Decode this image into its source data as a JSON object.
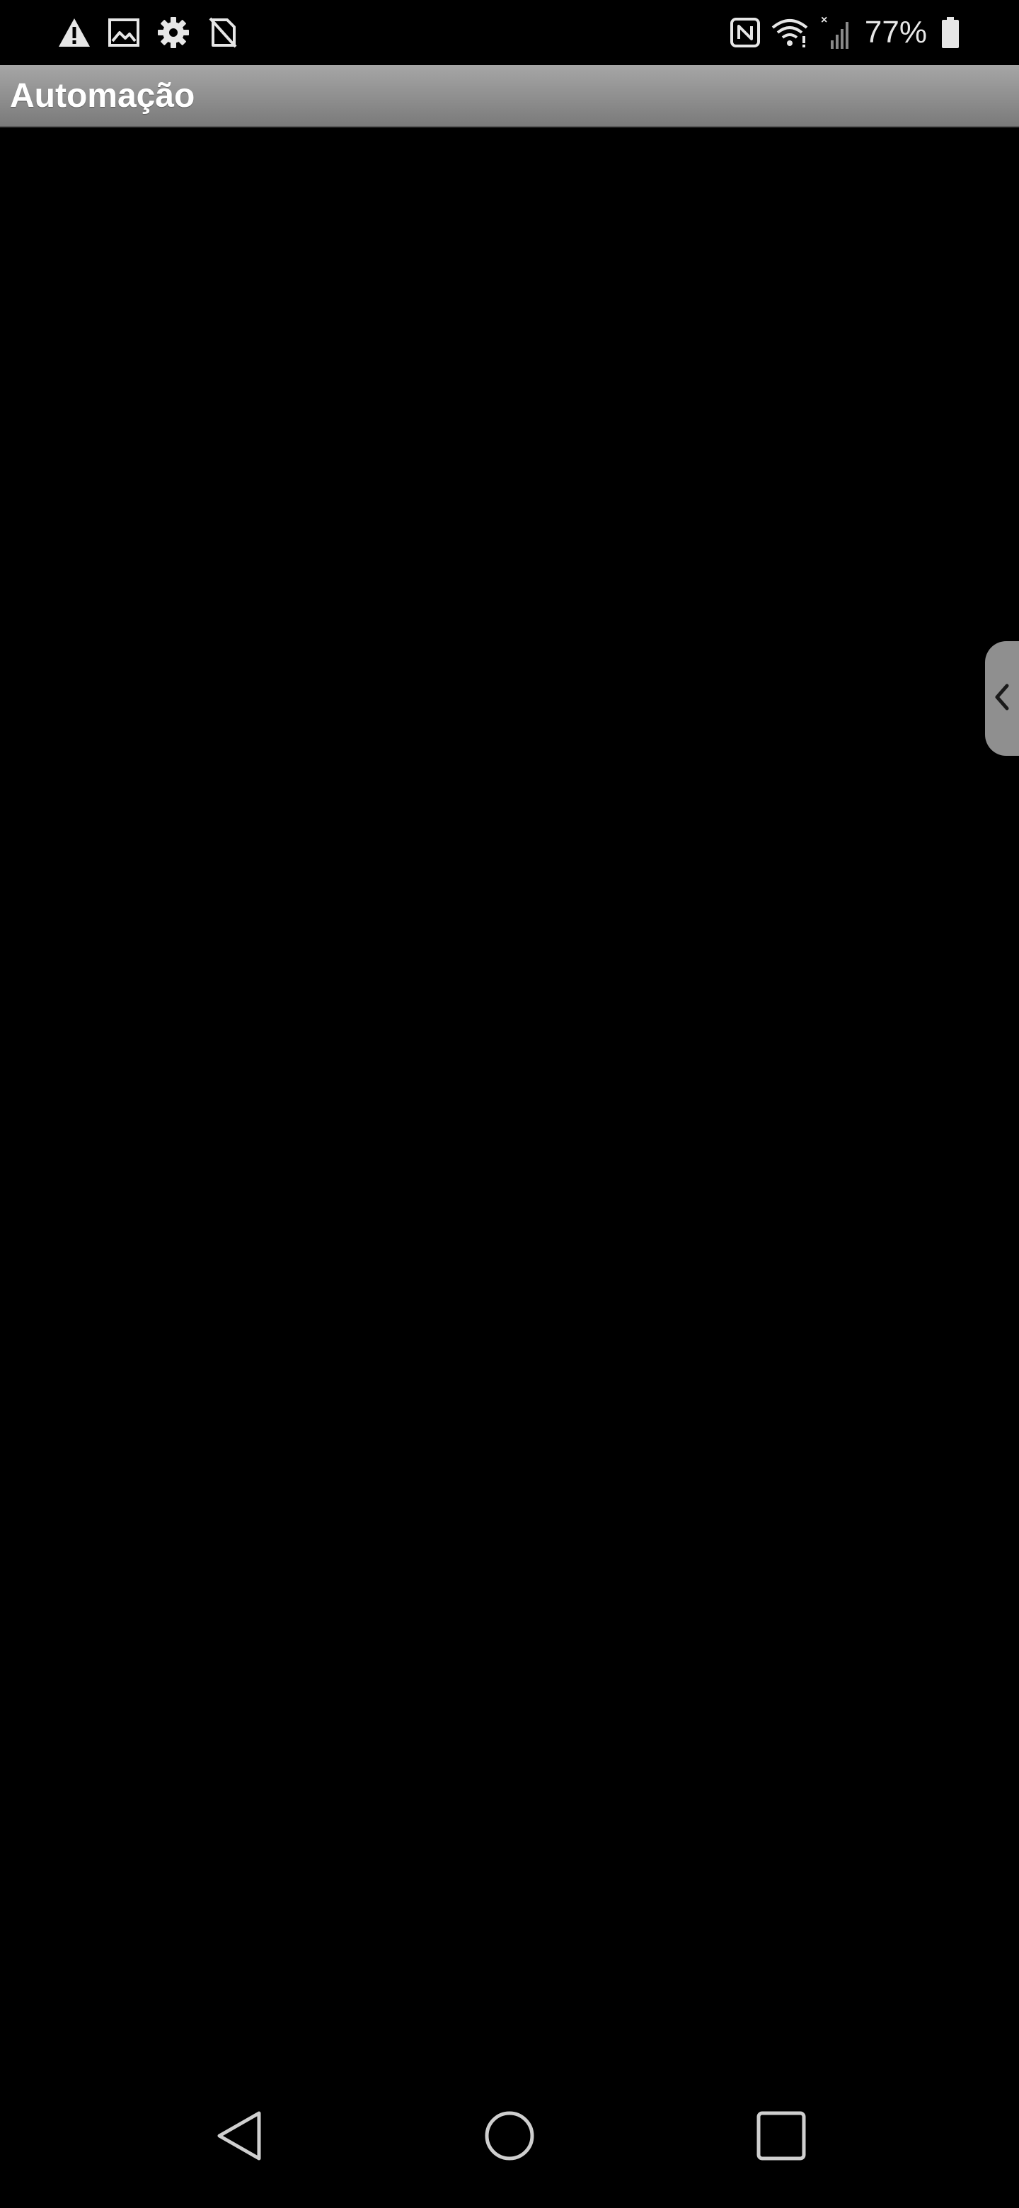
{
  "status_bar": {
    "left_icons": [
      "warning-icon",
      "image-icon",
      "settings-gear-icon",
      "no-sim-icon"
    ],
    "right_icons": [
      "nfc-icon",
      "wifi-icon",
      "signal-icon",
      "battery-icon"
    ],
    "battery_percent": "77%",
    "icon_color": "#e6e6e6"
  },
  "app": {
    "title": "Automação",
    "title_bar_color": "#999999",
    "background": "#000000"
  },
  "edge_panel": {
    "icon": "chevron-left-icon",
    "color": "#8f8f8f"
  },
  "nav_bar": {
    "buttons": [
      "back-icon",
      "home-icon",
      "recent-apps-icon"
    ],
    "icon_color": "#bdbdbd"
  }
}
